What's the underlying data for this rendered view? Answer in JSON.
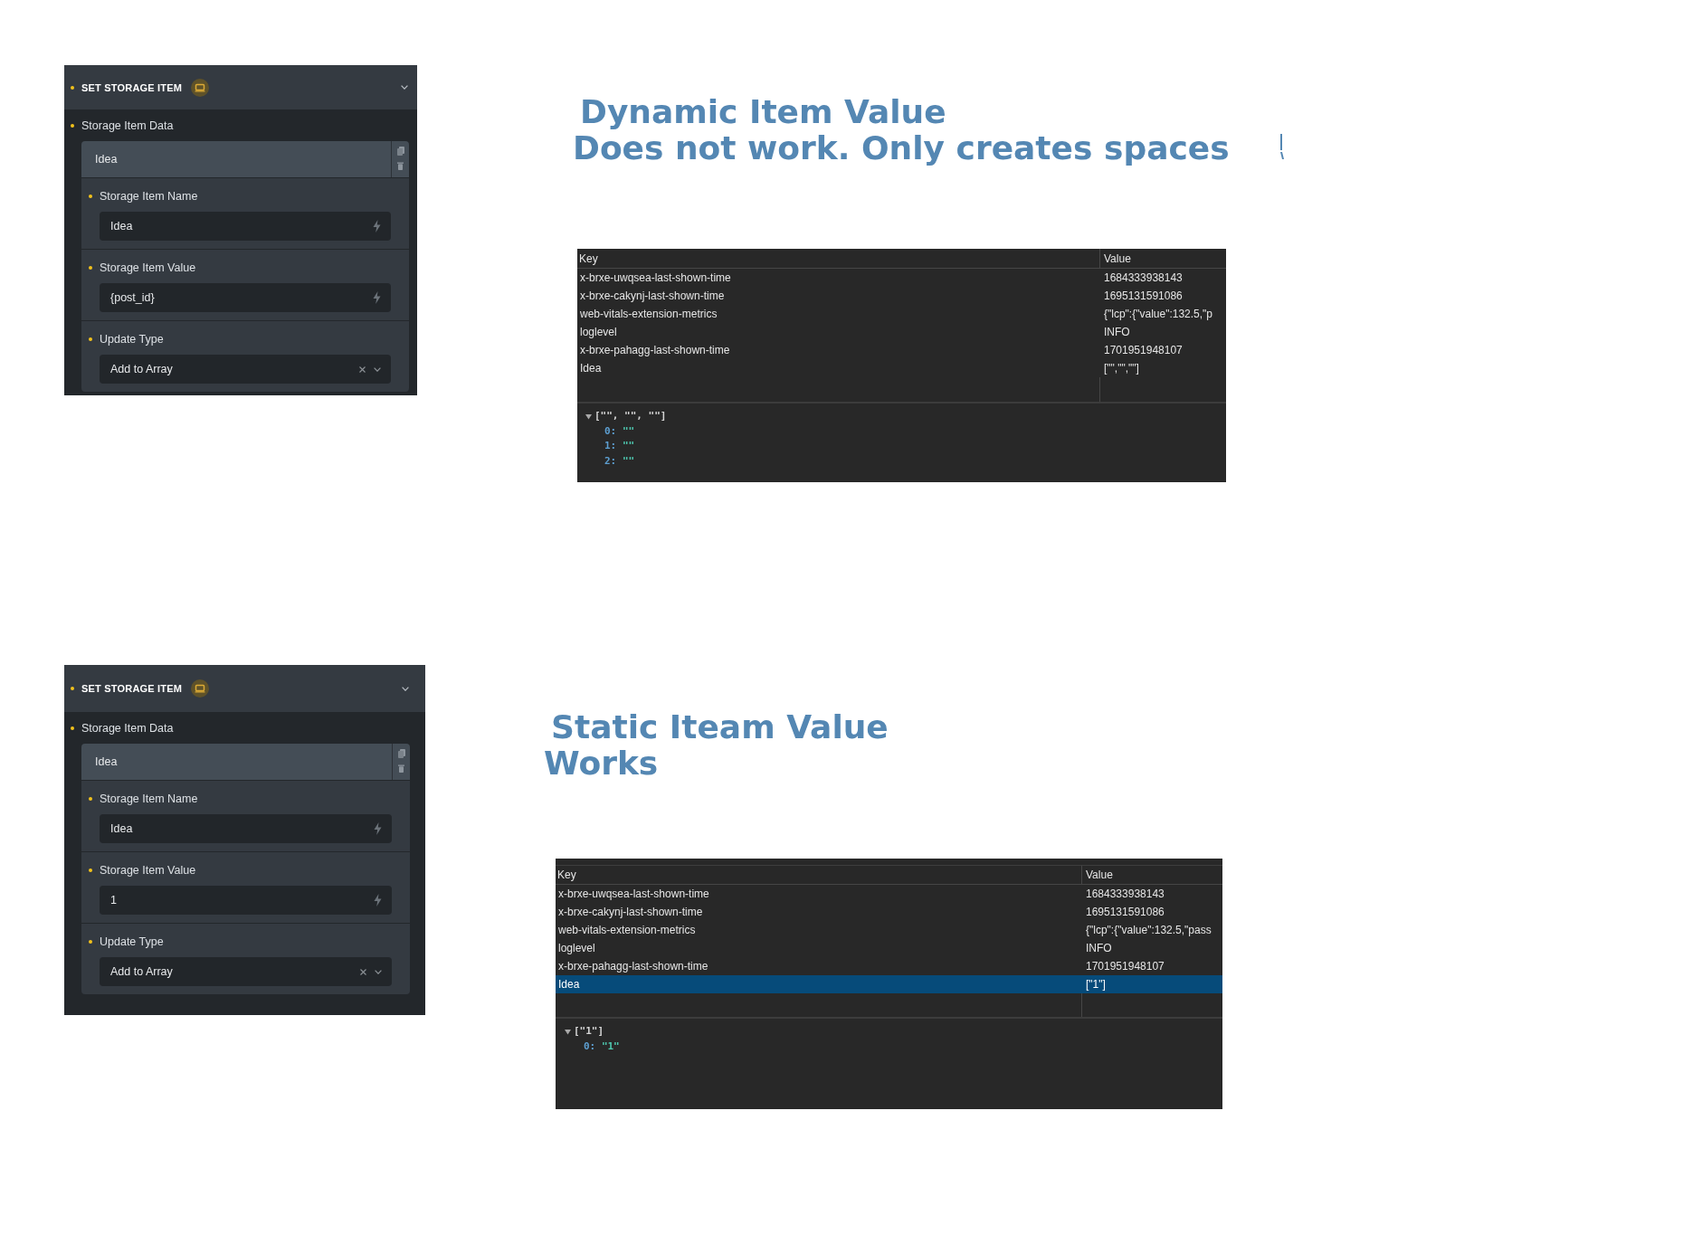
{
  "sections": [
    {
      "panel": {
        "title": "SET STORAGE ITEM",
        "group_label": "Storage Item Data",
        "item_title": "Idea",
        "fields": [
          {
            "kind": "text",
            "label": "Storage Item Name",
            "value": "Idea"
          },
          {
            "kind": "text",
            "label": "Storage Item Value",
            "value": "{post_id}"
          },
          {
            "kind": "select",
            "label": "Update Type",
            "value": "Add to Array"
          }
        ]
      },
      "heading": {
        "title": "Dynamic Item Value",
        "note": "Does not work. Only creates spaces"
      },
      "storage_table": {
        "columns": [
          "Key",
          "Value"
        ],
        "rows": [
          {
            "key": "x-brxe-uwqsea-last-shown-time",
            "value": "1684333938143",
            "selected": false
          },
          {
            "key": "x-brxe-cakynj-last-shown-time",
            "value": "1695131591086",
            "selected": false
          },
          {
            "key": "web-vitals-extension-metrics",
            "value": "{\"lcp\":{\"value\":132.5,\"p",
            "selected": false
          },
          {
            "key": "loglevel",
            "value": "INFO",
            "selected": false
          },
          {
            "key": "x-brxe-pahagg-last-shown-time",
            "value": "1701951948107",
            "selected": false
          },
          {
            "key": "Idea",
            "value": "[\"\",\"\",\"\"]",
            "selected": false
          }
        ],
        "preview": {
          "summary": "[\"\", \"\", \"\"]",
          "expanded": true,
          "entries": [
            {
              "index": "0:",
              "value": "\"\""
            },
            {
              "index": "1:",
              "value": "\"\""
            },
            {
              "index": "2:",
              "value": "\"\""
            }
          ]
        }
      }
    },
    {
      "panel": {
        "title": "SET STORAGE ITEM",
        "group_label": "Storage Item Data",
        "item_title": "Idea",
        "fields": [
          {
            "kind": "text",
            "label": "Storage Item Name",
            "value": "Idea"
          },
          {
            "kind": "text",
            "label": "Storage Item Value",
            "value": "1"
          },
          {
            "kind": "select",
            "label": "Update Type",
            "value": "Add to Array"
          }
        ]
      },
      "heading": {
        "title": "Static Iteam Value",
        "note": "Works"
      },
      "storage_table": {
        "columns": [
          "Key",
          "Value"
        ],
        "rows": [
          {
            "key": "x-brxe-uwqsea-last-shown-time",
            "value": "1684333938143",
            "selected": false
          },
          {
            "key": "x-brxe-cakynj-last-shown-time",
            "value": "1695131591086",
            "selected": false
          },
          {
            "key": "web-vitals-extension-metrics",
            "value": "{\"lcp\":{\"value\":132.5,\"pass",
            "selected": false
          },
          {
            "key": "loglevel",
            "value": "INFO",
            "selected": false
          },
          {
            "key": "x-brxe-pahagg-last-shown-time",
            "value": "1701951948107",
            "selected": false
          },
          {
            "key": "Idea",
            "value": "[\"1\"]",
            "selected": true
          }
        ],
        "preview": {
          "summary": "[\"1\"]",
          "expanded": true,
          "entries": [
            {
              "index": "0:",
              "value": "\"1\""
            }
          ]
        }
      }
    }
  ]
}
